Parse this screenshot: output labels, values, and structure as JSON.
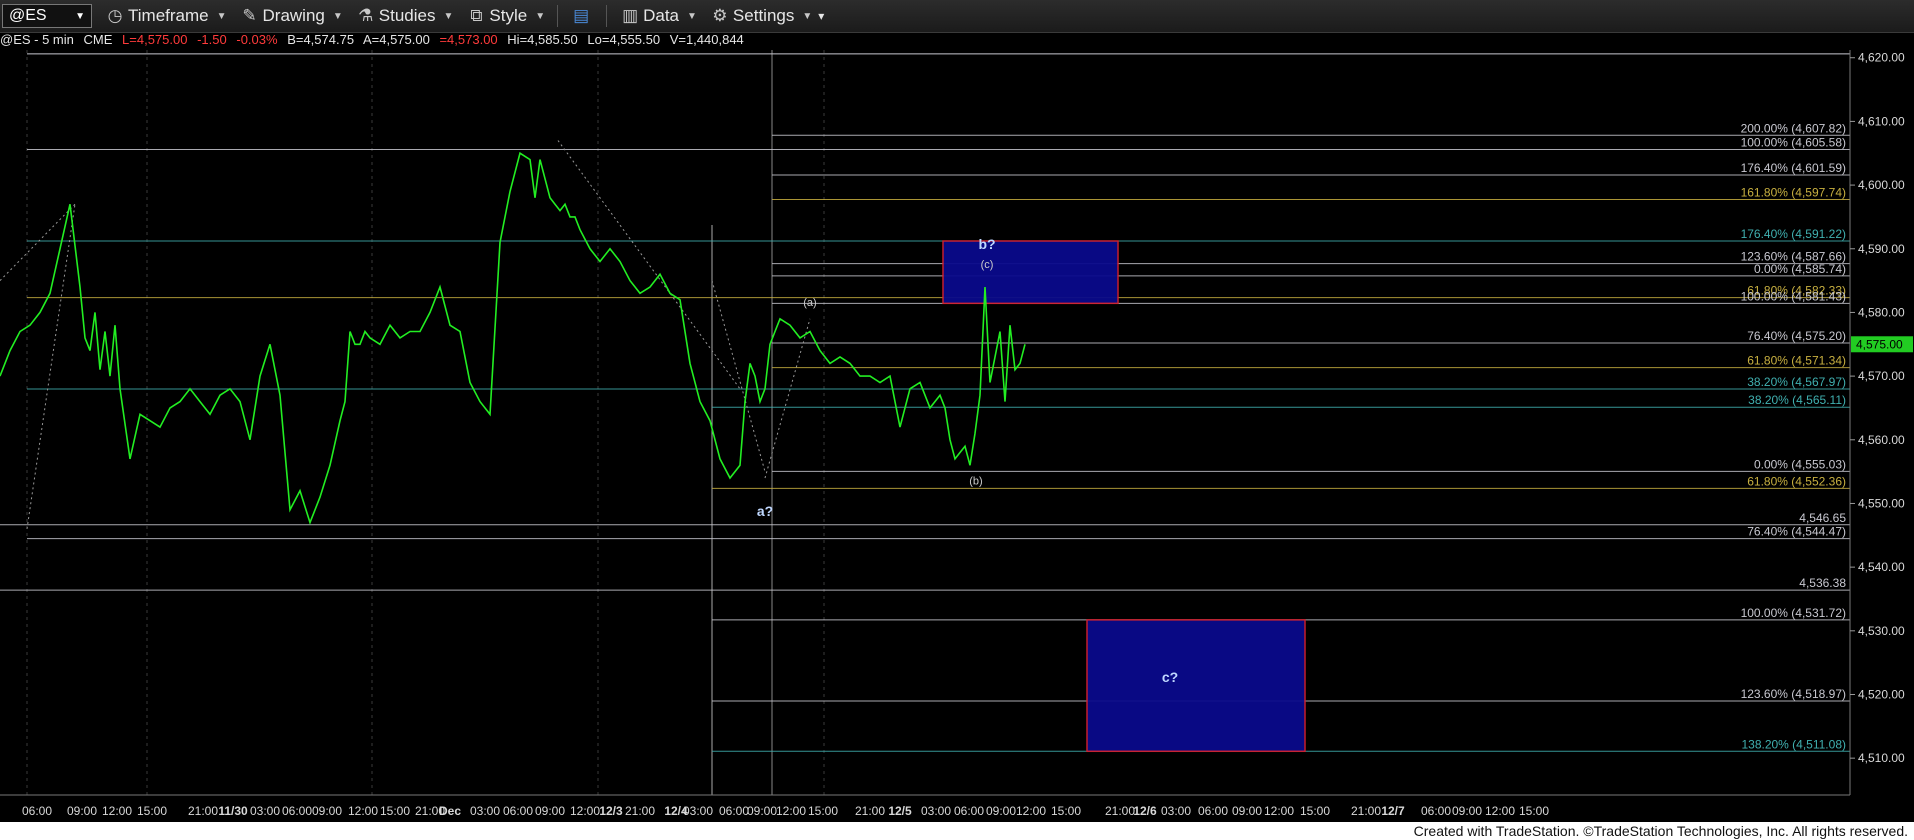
{
  "toolbar": {
    "symbol": "@ES",
    "timeframe_label": "Timeframe",
    "drawing_label": "Drawing",
    "studies_label": "Studies",
    "style_label": "Style",
    "data_label": "Data",
    "settings_label": "Settings"
  },
  "infobar": {
    "symbol": "@ES - 5 min",
    "exchange": "CME",
    "last": "L=4,575.00",
    "change": "-1.50",
    "change_pct": "-0.03%",
    "bid": "B=4,574.75",
    "ask": "A=4,575.00",
    "other": "=4,573.00",
    "high": "Hi=4,585.50",
    "low": "Lo=4,555.50",
    "volume": "V=1,440,844"
  },
  "footer": "Created with TradeStation. ©TradeStation Technologies, Inc. All rights reserved.",
  "chart_data": {
    "type": "line",
    "ylim": [
      4505,
      4622
    ],
    "y_ticks": [
      "4,510.00",
      "4,520.00",
      "4,530.00",
      "4,540.00",
      "4,550.00",
      "4,560.00",
      "4,570.00",
      "4,580.00",
      "4,590.00",
      "4,600.00",
      "4,610.00",
      "4,620.00"
    ],
    "y_tick_values": [
      4510,
      4520,
      4530,
      4540,
      4550,
      4560,
      4570,
      4580,
      4590,
      4600,
      4610,
      4620
    ],
    "last_price_label": "4,575.00",
    "last_price": 4575,
    "x_ticks": [
      "06:00",
      "09:00",
      "12:00",
      "15:00",
      "21:00",
      "11/30",
      "03:00",
      "06:00",
      "09:00",
      "12:00",
      "15:00",
      "21:00",
      "Dec",
      "03:00",
      "06:00",
      "09:00",
      "12:00",
      "12/3",
      "21:00",
      "12/4",
      "03:00",
      "06:00",
      "09:00",
      "12:00",
      "15:00",
      "21:00",
      "12/5",
      "03:00",
      "06:00",
      "09:00",
      "12:00",
      "15:00",
      "21:00",
      "12/6",
      "03:00",
      "06:00",
      "09:00",
      "12:00",
      "15:00",
      "21:00",
      "12/7",
      "06:00",
      "09:00",
      "12:00",
      "15:00"
    ],
    "series": [
      {
        "color": "#22ee22",
        "x": [
          0,
          10,
          20,
          30,
          40,
          50,
          60,
          70,
          80,
          85,
          90,
          95,
          100,
          105,
          110,
          115,
          120,
          130,
          140,
          150,
          160,
          170,
          180,
          190,
          200,
          210,
          220,
          230,
          240,
          250,
          260,
          270,
          280,
          290,
          300,
          310,
          320,
          330,
          340,
          345,
          350,
          355,
          360,
          365,
          370,
          380,
          390,
          400,
          410,
          420,
          430,
          440,
          450,
          460,
          470,
          480,
          490,
          500,
          510,
          520,
          530,
          535,
          540,
          545,
          550,
          555,
          560,
          565,
          570,
          575,
          580,
          590,
          600,
          610,
          620,
          630,
          640,
          650,
          660,
          670,
          680,
          690,
          700,
          710,
          720,
          730,
          740,
          745,
          750,
          755,
          760,
          765,
          770,
          775,
          780,
          790,
          800,
          810,
          820,
          830,
          840,
          850,
          860,
          870,
          880,
          890,
          900,
          910,
          920,
          930,
          940,
          945,
          950,
          955,
          960,
          965,
          970,
          975,
          980,
          985,
          990,
          995,
          1000,
          1005,
          1010,
          1015,
          1020,
          1025
        ],
        "y": [
          4570,
          4574,
          4577,
          4578,
          4580,
          4583,
          4590,
          4597,
          4584,
          4576,
          4574,
          4580,
          4571,
          4577,
          4570,
          4578,
          4568,
          4557,
          4564,
          4563,
          4562,
          4565,
          4566,
          4568,
          4566,
          4564,
          4567,
          4568,
          4566,
          4560,
          4570,
          4575,
          4567,
          4549,
          4552,
          4547,
          4551,
          4556,
          4563,
          4566,
          4577,
          4575,
          4575,
          4577,
          4576,
          4575,
          4578,
          4576,
          4577,
          4577,
          4580,
          4584,
          4578,
          4577,
          4569,
          4566,
          4564,
          4591,
          4599,
          4605,
          4604,
          4598,
          4604,
          4601,
          4598,
          4597,
          4596,
          4597,
          4595,
          4595,
          4593,
          4590,
          4588,
          4590,
          4588,
          4585,
          4583,
          4584,
          4586,
          4583,
          4582,
          4572,
          4566,
          4563,
          4557,
          4554,
          4556,
          4566,
          4572,
          4570,
          4566,
          4568,
          4575,
          4577,
          4579,
          4578,
          4576,
          4577,
          4574,
          4572,
          4573,
          4572,
          4570,
          4570,
          4569,
          4570,
          4562,
          4568,
          4569,
          4565,
          4567,
          4565,
          4560,
          4557,
          4558,
          4559,
          4556,
          4561,
          4567,
          4584,
          4569,
          4573,
          4577,
          4566,
          4578,
          4571,
          4572,
          4575
        ]
      }
    ],
    "fib_levels": [
      {
        "label": "200.00% (4,607.82)",
        "value": 4607.82,
        "color": "#c8c8d0"
      },
      {
        "label": "100.00% (4,605.58)",
        "value": 4605.58,
        "color": "#c8c8d0"
      },
      {
        "label": "176.40% (4,601.59)",
        "value": 4601.59,
        "color": "#c8c8d0"
      },
      {
        "label": "161.80% (4,597.74)",
        "value": 4597.74,
        "color": "#c8b040"
      },
      {
        "label": "176.40% (4,591.22)",
        "value": 4591.22,
        "color": "#40b0b0"
      },
      {
        "label": "123.60% (4,587.66)",
        "value": 4587.66,
        "color": "#c8c8d0"
      },
      {
        "label": "0.00% (4,585.74)",
        "value": 4585.74,
        "color": "#c8c8d0"
      },
      {
        "label": "61.80% (4,582.33)",
        "value": 4582.33,
        "color": "#c8b040"
      },
      {
        "label": "100.00% (4,581.43)",
        "value": 4581.43,
        "color": "#c8c8d0"
      },
      {
        "label": "76.40% (4,575.20)",
        "value": 4575.2,
        "color": "#c8c8d0"
      },
      {
        "label": "61.80% (4,571.34)",
        "value": 4571.34,
        "color": "#c8b040"
      },
      {
        "label": "38.20% (4,567.97)",
        "value": 4567.97,
        "color": "#40b0b0"
      },
      {
        "label": "38.20% (4,565.11)",
        "value": 4565.11,
        "color": "#40b0b0"
      },
      {
        "label": "0.00% (4,555.03)",
        "value": 4555.03,
        "color": "#c8c8d0"
      },
      {
        "label": "61.80% (4,552.36)",
        "value": 4552.36,
        "color": "#c8b040"
      },
      {
        "label": "4,546.65",
        "value": 4546.65,
        "color": "#c8c8d0"
      },
      {
        "label": "76.40% (4,544.47)",
        "value": 4544.47,
        "color": "#c8c8d0"
      },
      {
        "label": "4,536.38",
        "value": 4536.38,
        "color": "#c8c8d0"
      },
      {
        "label": "100.00% (4,531.72)",
        "value": 4531.72,
        "color": "#c8c8d0"
      },
      {
        "label": "123.60% (4,518.97)",
        "value": 4518.97,
        "color": "#c8c8d0"
      },
      {
        "label": "138.20% (4,511.08)",
        "value": 4511.08,
        "color": "#40b0b0"
      }
    ],
    "annotations": [
      {
        "text": "a?",
        "x": 765,
        "y": 4548
      },
      {
        "text": "(a)",
        "x": 810,
        "y": 4581
      },
      {
        "text": "b?",
        "x": 987,
        "y": 4590
      },
      {
        "text": "(c)",
        "x": 987,
        "y": 4587
      },
      {
        "text": "(b)",
        "x": 976,
        "y": 4553
      },
      {
        "text": "c?",
        "x": 1170,
        "y": 4522
      }
    ],
    "boxes": [
      {
        "name": "b-target-zone",
        "x0": 943,
        "x1": 1118,
        "y0": 4581.43,
        "y1": 4591.22
      },
      {
        "name": "c-target-zone",
        "x0": 1087,
        "x1": 1305,
        "y0": 4511.08,
        "y1": 4531.72
      }
    ]
  }
}
